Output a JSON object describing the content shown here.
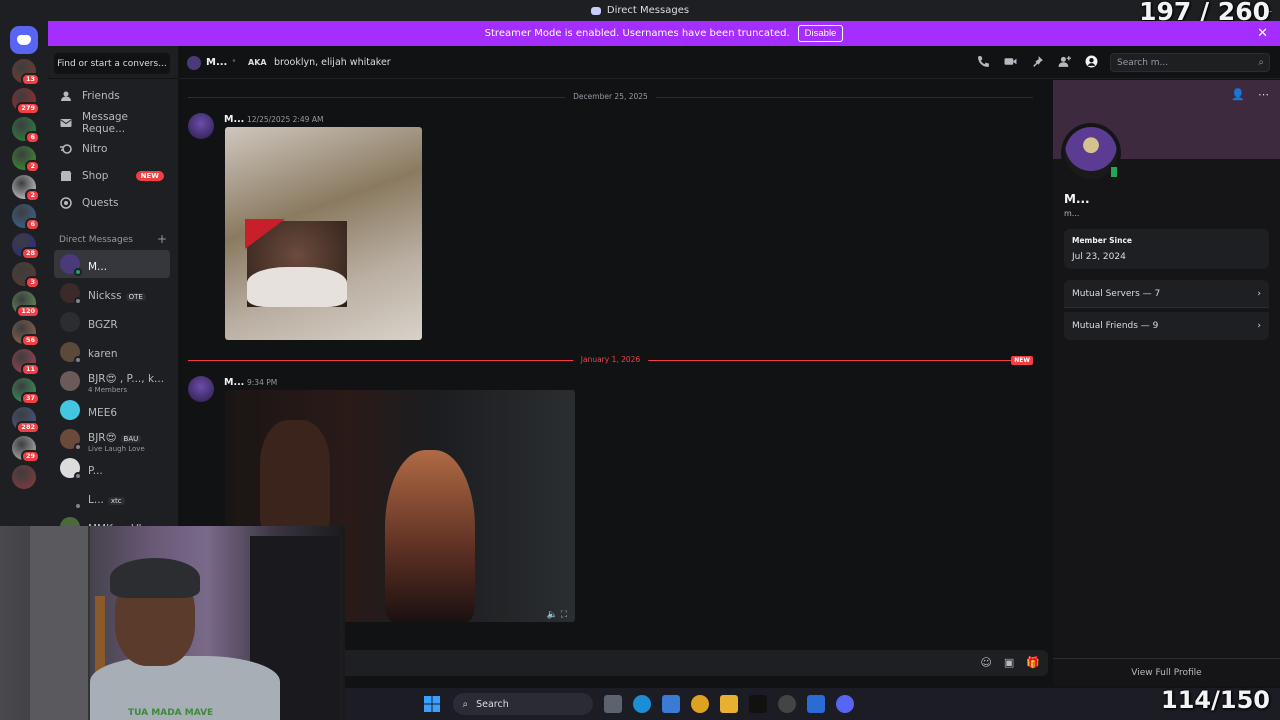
{
  "titlebar": {
    "title": "Direct Messages"
  },
  "overlay": {
    "top_counter": "197 / 260",
    "bottom_counter": "114/150"
  },
  "banner": {
    "text": "Streamer Mode is enabled. Usernames have been truncated.",
    "disable_label": "Disable",
    "close": "✕"
  },
  "rail": {
    "servers": [
      {
        "color": "#7a3a2a",
        "badge": "13"
      },
      {
        "color": "#a82a2a",
        "badge": "279"
      },
      {
        "color": "#2a8a3a",
        "badge": "6"
      },
      {
        "color": "#3a9a2a",
        "badge": "2"
      },
      {
        "color": "#dcdcdc",
        "badge": "2"
      },
      {
        "color": "#3a6a9a",
        "badge": "6"
      },
      {
        "color": "#2a2a8a",
        "badge": "28"
      },
      {
        "color": "#5a3a2a",
        "badge": "3"
      },
      {
        "color": "#6a9a5a",
        "badge": "120"
      },
      {
        "color": "#9a6a4a",
        "badge": "56"
      },
      {
        "color": "#b04050",
        "badge": "11"
      },
      {
        "color": "#3aa05a",
        "badge": "37"
      },
      {
        "color": "#4a5a8a",
        "badge": "282"
      },
      {
        "color": "#c0c0c0",
        "badge": "29"
      },
      {
        "color": "#8a3a3a",
        "badge": ""
      }
    ]
  },
  "sidebar": {
    "find_label": "Find or start a convers...",
    "nav": [
      {
        "label": "Friends",
        "icon": "friends-icon"
      },
      {
        "label": "Message Reque...",
        "icon": "envelope-icon"
      },
      {
        "label": "Nitro",
        "icon": "nitro-icon"
      },
      {
        "label": "Shop",
        "icon": "shop-icon",
        "badge": "NEW"
      },
      {
        "label": "Quests",
        "icon": "quests-icon"
      }
    ],
    "dm_header": "Direct Messages",
    "dm_add": "+",
    "dms": [
      {
        "name": "M...",
        "sub": "",
        "tag": "",
        "color": "#4a3a7a",
        "status": "#23a55a",
        "active": true
      },
      {
        "name": "Nickss",
        "sub": "",
        "tag": "OTE",
        "color": "#3a2a2a",
        "status": "#80848e"
      },
      {
        "name": "BGZR",
        "sub": "",
        "tag": "",
        "color": "#2b2d31",
        "status": ""
      },
      {
        "name": "karen",
        "sub": "",
        "tag": "",
        "color": "#5a4a3a",
        "status": "#80848e"
      },
      {
        "name": "BJR😍 , P..., k...",
        "sub": "4 Members",
        "tag": "",
        "color": "#6a5a5a",
        "status": ""
      },
      {
        "name": "MEE6",
        "sub": "",
        "tag": "",
        "color": "#45c6e0",
        "status": ""
      },
      {
        "name": "BJR😍",
        "sub": "Live Laugh Love",
        "tag": "BAU",
        "color": "#6a4a3a",
        "status": "#80848e"
      },
      {
        "name": "P...",
        "sub": "",
        "tag": "",
        "color": "#dcdcdc",
        "status": "#80848e"
      },
      {
        "name": "L...",
        "sub": "",
        "tag": "xtc",
        "color": "#1e1f22",
        "status": "#80848e"
      },
      {
        "name": "MMK vs VI",
        "sub": "",
        "tag": "",
        "color": "#4a6a3a",
        "status": ""
      }
    ]
  },
  "header": {
    "name": "M...",
    "aka_label": "AKA",
    "aka_names": "brooklyn, elijah whitaker",
    "search_placeholder": "Search m...",
    "icons": [
      "phone-icon",
      "video-icon",
      "pin-icon",
      "add-friend-icon",
      "profile-icon"
    ]
  },
  "messages": {
    "dividers": [
      {
        "label": "December 25, 2025",
        "new": false
      },
      {
        "label": "January 1, 2026",
        "new": true,
        "new_label": "NEW"
      }
    ],
    "items": [
      {
        "author": "M...",
        "time": "12/25/2025 2:49 AM"
      },
      {
        "author": "M...",
        "time": "9:34 PM"
      }
    ]
  },
  "profile": {
    "name": "M...",
    "username": "m...",
    "member_since_label": "Member Since",
    "member_since_value": "Jul 23, 2024",
    "mutual_servers": "Mutual Servers — 7",
    "mutual_friends": "Mutual Friends — 9",
    "view_full": "View Full Profile"
  },
  "taskbar": {
    "search_label": "Search"
  },
  "webcam": {
    "shirt_text": "TUA MADA MAVE"
  }
}
